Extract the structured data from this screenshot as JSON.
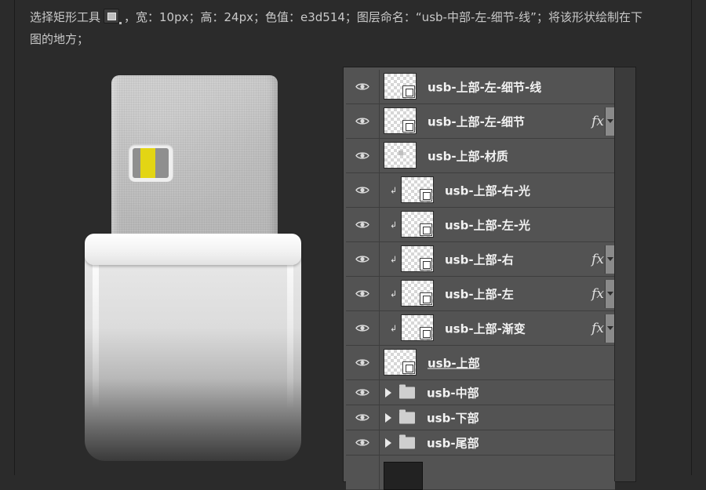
{
  "instruction": {
    "line1_part1": "选择矩形工具",
    "line1_part2": "，宽：10px；高：24px；色值：e3d514；图层命名：“usb-中部-左-细节-线”；将该形状绘制在下",
    "line2": "图的地方；"
  },
  "illustration": {
    "stripe_color": "#e3d514"
  },
  "layers_panel": {
    "layers": [
      {
        "name": "usb-上部-左-细节-线",
        "clipped": false,
        "fx": false,
        "thumb": "shape"
      },
      {
        "name": "usb-上部-左-细节",
        "clipped": false,
        "fx": true,
        "thumb": "shape"
      },
      {
        "name": "usb-上部-材质",
        "clipped": false,
        "fx": false,
        "thumb": "pixel"
      },
      {
        "name": "usb-上部-右-光",
        "clipped": true,
        "fx": false,
        "thumb": "shape"
      },
      {
        "name": "usb-上部-左-光",
        "clipped": true,
        "fx": false,
        "thumb": "shape"
      },
      {
        "name": "usb-上部-右",
        "clipped": true,
        "fx": true,
        "thumb": "shape"
      },
      {
        "name": "usb-上部-左",
        "clipped": true,
        "fx": true,
        "thumb": "shape"
      },
      {
        "name": "usb-上部-渐变",
        "clipped": true,
        "fx": true,
        "thumb": "shape"
      },
      {
        "name": "usb-上部",
        "clipped": false,
        "fx": false,
        "thumb": "shape",
        "underline": true
      }
    ],
    "groups": [
      {
        "name": "usb-中部"
      },
      {
        "name": "usb-下部"
      },
      {
        "name": "usb-尾部"
      }
    ],
    "fx_label": "fx"
  }
}
